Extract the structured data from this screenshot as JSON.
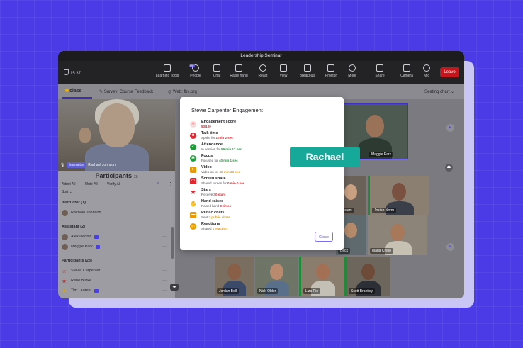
{
  "window": {
    "title": "Leadership Seminar"
  },
  "toolbar": {
    "timer": "15:37",
    "items": [
      {
        "label": "Learning Tools",
        "icon": "learning-tools-icon"
      },
      {
        "label": "People",
        "icon": "people-icon",
        "count": "99+"
      },
      {
        "label": "Chat",
        "icon": "chat-icon"
      },
      {
        "label": "Raise hand",
        "icon": "raise-hand-icon"
      },
      {
        "label": "React",
        "icon": "react-icon"
      },
      {
        "label": "View",
        "icon": "view-icon"
      },
      {
        "label": "Breakouts",
        "icon": "breakouts-icon"
      },
      {
        "label": "Proctor",
        "icon": "proctor-icon"
      },
      {
        "label": "More",
        "icon": "more-icon"
      },
      {
        "label": "Share",
        "icon": "share-icon"
      },
      {
        "label": "Camera",
        "icon": "camera-icon"
      },
      {
        "label": "Mic",
        "icon": "mic-icon"
      }
    ],
    "leave": "Leave"
  },
  "tabs": {
    "logo": "class",
    "survey": "Survey: Course Feedback",
    "web": "Web: fbx.org",
    "seating": "Seating chart"
  },
  "self_video": {
    "role": "Instructor",
    "name": "Rachael Johnson"
  },
  "participants": {
    "title": "Participants",
    "count": "28",
    "actions": [
      "Admit All",
      "Mute All",
      "Verify All"
    ],
    "sort": "Sort",
    "sections": [
      {
        "label": "Instructor (1)",
        "people": [
          {
            "name": "Rachael Johnson"
          }
        ]
      },
      {
        "label": "Assistant (2)",
        "people": [
          {
            "name": "Alex Dennis"
          },
          {
            "name": "Maggie Park"
          }
        ]
      },
      {
        "label": "Participants (23)",
        "people": [
          {
            "name": "Stevie Carpenter"
          },
          {
            "name": "Rene Burke"
          },
          {
            "name": "Tim Laurent"
          }
        ]
      }
    ]
  },
  "videos": [
    {
      "name": "Maggie Park"
    },
    {
      "name": "Laurent"
    },
    {
      "name": "Josiah Norm"
    },
    {
      "name": "Beck"
    },
    {
      "name": "Maria Chino"
    },
    {
      "name": "Jordan Bell"
    },
    {
      "name": "Nick Older"
    },
    {
      "name": "Liza Rio"
    },
    {
      "name": "Scott Brantley"
    }
  ],
  "modal": {
    "title": "Stevie Carpenter Engagement",
    "metrics": [
      {
        "label": "Engagement score",
        "prefix": "",
        "value": "53/100",
        "color": "#e0262e",
        "icon": "engagement-score-icon"
      },
      {
        "label": "Talk time",
        "prefix": "Spoke for ",
        "value": "1 min 2 sec",
        "color": "#e0262e",
        "icon": "talk-time-icon"
      },
      {
        "label": "Attendance",
        "prefix": "In session for ",
        "value": "59 min 12 sec",
        "color": "#1e9c3a",
        "icon": "attendance-icon"
      },
      {
        "label": "Focus",
        "prefix": "Focused for ",
        "value": "40 min 1 sec",
        "color": "#1e9c3a",
        "icon": "focus-icon"
      },
      {
        "label": "Video",
        "prefix": "Video on for ",
        "value": "32 min 33 sec",
        "color": "#e89a00",
        "icon": "video-icon"
      },
      {
        "label": "Screen share",
        "prefix": "Shared screen for ",
        "value": "0 min 0 sec",
        "color": "#e0262e",
        "icon": "screen-share-icon"
      },
      {
        "label": "Stars",
        "prefix": "Received ",
        "value": "0 stars",
        "color": "#e0262e",
        "icon": "stars-icon"
      },
      {
        "label": "Hand raises",
        "prefix": "Raised hand ",
        "value": "0 times",
        "color": "#e0262e",
        "icon": "hand-raise-icon"
      },
      {
        "label": "Public chats",
        "prefix": "Sent ",
        "value": "2 public chats",
        "color": "#e89a00",
        "icon": "public-chats-icon"
      },
      {
        "label": "Reactions",
        "prefix": "Shared ",
        "value": "1 reaction",
        "color": "#e89a00",
        "icon": "reactions-icon"
      }
    ],
    "close": "Close"
  },
  "cursor_tag": "Rachael"
}
